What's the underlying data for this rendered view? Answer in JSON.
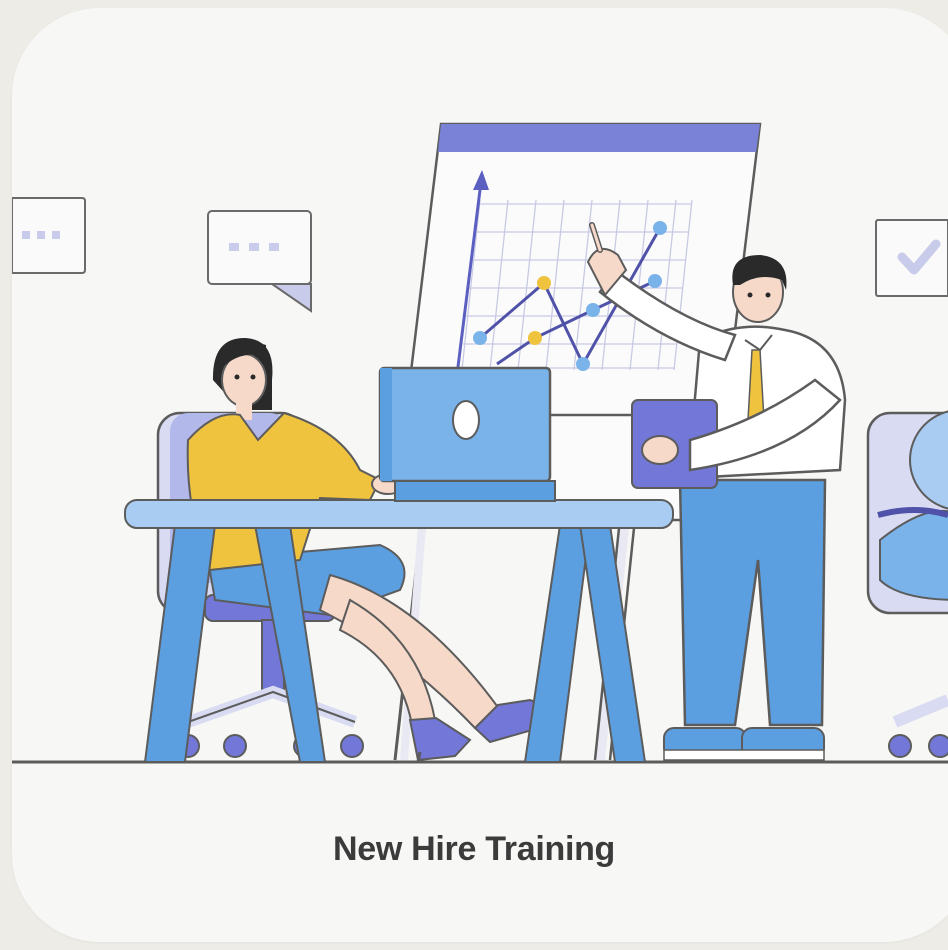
{
  "card": {
    "caption": "New Hire Training"
  },
  "illustration": {
    "subject": "office presentation",
    "colors": {
      "accent_blue": "#5b9fe0",
      "purple": "#7277d8",
      "yellow": "#f0c33f",
      "skin": "#f6d9c8",
      "dark_hair": "#2a2a2a",
      "board_header": "#7a82d8"
    }
  }
}
